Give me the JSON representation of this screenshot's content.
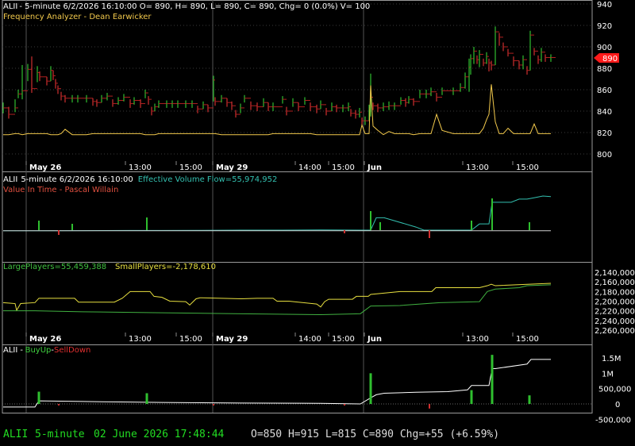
{
  "colors": {
    "background": "#000000",
    "panel_border": "#9a9a9a",
    "grid": "#3a3a3a",
    "up": "#2fbf2f",
    "down": "#d03030",
    "osc": "#f2c94c",
    "teal": "#33c0b0",
    "line_white": "#ffffff",
    "yellow": "#e8e040",
    "green_line": "#40b040",
    "status_green": "#22dd22",
    "status_white": "#dddddd",
    "price_tag": "#ff1a1a"
  },
  "panels": {
    "price": {
      "title_symbol": "ALII",
      "title_rest": "- 5-minute 6/2/2026 16:10:00 O= 890, H= 890, L= 890, C= 890, Chg= 0 (0.0%) V= 100",
      "subtitle": "Frequency Analyzer - Dean Earwicker",
      "last_price_tag": "890",
      "y_ticks": [
        "940",
        "920",
        "900",
        "880",
        "860",
        "840",
        "820",
        "800"
      ]
    },
    "volume": {
      "title_symbol": "ALII",
      "title_rest": "5-minute 6/2/2026 16:10:00",
      "evf_label": "Effective Volume Flow=55,974,952",
      "vit_label": "Value In Time - Pascal Willain"
    },
    "players": {
      "large_label": "LargePlayers=55,459,388",
      "small_label": "SmallPlayers=-2,178,610",
      "y_ticks": [
        "2,140,000",
        "2,160,000",
        "2,180,000",
        "2,200,000",
        "2,220,000",
        "2,240,000",
        "2,260,000"
      ]
    },
    "buyup": {
      "title_symbol": "ALII",
      "dash": "-",
      "buy_label": "BuyUp",
      "sep": "-",
      "sell_label": "SellDown",
      "y_ticks": [
        "1.5M",
        "1M",
        "500,000",
        "0",
        "-500,000"
      ]
    }
  },
  "x_labels": {
    "top": [
      "May 26",
      "13:00",
      "15:00",
      "May 29",
      "14:00",
      "15:00",
      "Jun",
      "13:00",
      "15:00"
    ],
    "middle": [
      "May 26",
      "13:00",
      "15:00",
      "May 29",
      "14:00",
      "15:00",
      "Jun",
      "13:00",
      "15:00"
    ]
  },
  "status_bar": {
    "symbol": "ALII",
    "interval": "5-minute",
    "datetime": "02 June 2026 17:48:44",
    "ohlc": "O=850  H=915  L=815  C=890  Chg=+55 (+6.59%)"
  },
  "chart_data": [
    {
      "type": "line",
      "panel": "price",
      "series": [
        {
          "x": [
            0,
            7,
            15,
            19,
            24,
            31,
            36,
            43,
            46,
            55,
            60,
            63,
            66,
            69,
            73,
            78,
            87,
            94,
            105,
            113,
            118,
            124,
            131,
            138,
            145,
            152,
            160,
            165,
            173,
            179,
            183,
            187,
            191,
            196,
            206,
            213,
            220,
            230,
            238,
            245,
            252,
            258,
            265,
            267,
            275,
            282,
            288,
            293,
            299,
            304,
            312,
            320,
            328,
            334,
            340,
            352,
            357,
            365,
            372,
            380,
            387,
            395,
            400,
            407,
            414,
            420,
            428,
            435,
            438,
            444,
            449,
            452,
            456,
            461,
            463,
            466,
            472,
            479,
            486,
            493,
            501,
            507,
            511,
            517,
            525,
            533,
            539,
            546,
            553,
            567,
            576,
            582,
            587,
            589,
            593,
            597,
            600,
            605,
            609,
            612,
            615,
            620,
            625,
            630,
            636,
            643,
            650,
            655,
            660,
            664,
            669,
            674,
            678,
            683,
            690
          ],
          "close": [
            843,
            837,
            843,
            856,
            859,
            879,
            861,
            876,
            872,
            868,
            878,
            873,
            866,
            861,
            854,
            852,
            852,
            852,
            852,
            849,
            848,
            852,
            854,
            847,
            850,
            853,
            847,
            850,
            847,
            857,
            851,
            840,
            844,
            847,
            847,
            847,
            847,
            847,
            847,
            842,
            846,
            843,
            869,
            849,
            852,
            848,
            845,
            837,
            843,
            852,
            845,
            844,
            848,
            844,
            844,
            851,
            840,
            848,
            844,
            850,
            844,
            842,
            846,
            840,
            844,
            843,
            843,
            844,
            838,
            837,
            839,
            831,
            831,
            842,
            853,
            845,
            843,
            844,
            845,
            845,
            850,
            848,
            851,
            849,
            856,
            856,
            858,
            853,
            859,
            859,
            862,
            872,
            881,
            889,
            896,
            888,
            893,
            885,
            891,
            885,
            883,
            914,
            909,
            900,
            894,
            887,
            883,
            888,
            878,
            911,
            896,
            888,
            895,
            890,
            890
          ],
          "high": [
            848,
            844,
            851,
            860,
            883,
            884,
            891,
            882,
            877,
            872,
            882,
            878,
            870,
            864,
            858,
            855,
            855,
            855,
            855,
            852,
            851,
            855,
            857,
            851,
            853,
            856,
            851,
            853,
            851,
            860,
            854,
            844,
            847,
            850,
            850,
            850,
            850,
            850,
            850,
            845,
            849,
            846,
            873,
            853,
            855,
            852,
            849,
            841,
            847,
            855,
            849,
            848,
            852,
            848,
            848,
            854,
            844,
            852,
            848,
            853,
            848,
            846,
            850,
            843,
            848,
            846,
            846,
            848,
            842,
            841,
            843,
            834,
            835,
            846,
            875,
            848,
            847,
            848,
            849,
            848,
            853,
            852,
            854,
            852,
            860,
            860,
            862,
            857,
            862,
            862,
            866,
            876,
            889,
            893,
            900,
            892,
            897,
            889,
            895,
            889,
            887,
            919,
            913,
            904,
            898,
            891,
            887,
            892,
            882,
            915,
            899,
            892,
            899,
            893,
            893
          ],
          "low": [
            838,
            833,
            839,
            852,
            851,
            868,
            857,
            867,
            868,
            864,
            868,
            869,
            861,
            856,
            850,
            848,
            848,
            848,
            848,
            845,
            844,
            848,
            850,
            844,
            846,
            849,
            843,
            846,
            843,
            852,
            846,
            836,
            840,
            843,
            843,
            843,
            843,
            843,
            843,
            838,
            842,
            839,
            849,
            845,
            848,
            844,
            841,
            834,
            838,
            848,
            841,
            840,
            844,
            840,
            840,
            847,
            836,
            844,
            840,
            846,
            840,
            838,
            842,
            836,
            840,
            839,
            839,
            840,
            835,
            833,
            834,
            827,
            827,
            831,
            835,
            841,
            839,
            840,
            841,
            841,
            846,
            844,
            847,
            845,
            852,
            852,
            854,
            849,
            855,
            855,
            858,
            861,
            858,
            874,
            884,
            884,
            881,
            882,
            884,
            877,
            878,
            883,
            901,
            896,
            891,
            882,
            879,
            879,
            874,
            878,
            892,
            884,
            886,
            886,
            886
          ],
          "osc": [
            818,
            818,
            819,
            819,
            818,
            819,
            819,
            819,
            819,
            819,
            818,
            818,
            818,
            818,
            819,
            823,
            818,
            818,
            818,
            819,
            819,
            819,
            819,
            819,
            819,
            819,
            819,
            819,
            819,
            818,
            818,
            818,
            818,
            819,
            819,
            819,
            819,
            819,
            819,
            819,
            819,
            819,
            819,
            819,
            818,
            818,
            818,
            818,
            818,
            818,
            818,
            818,
            818,
            818,
            819,
            819,
            819,
            819,
            819,
            819,
            819,
            818,
            818,
            818,
            818,
            818,
            818,
            818,
            818,
            818,
            818,
            827,
            819,
            819,
            864,
            826,
            822,
            818,
            821,
            819,
            819,
            819,
            819,
            818,
            819,
            819,
            819,
            837,
            822,
            819,
            819,
            819,
            819,
            819,
            819,
            819,
            819,
            824,
            832,
            837,
            865,
            830,
            819,
            819,
            824,
            819,
            819,
            819,
            819,
            819,
            828,
            819,
            819,
            819,
            819
          ]
        }
      ]
    },
    {
      "type": "bar",
      "panel": "volume",
      "series": [
        {
          "name": "Effective Volume Flow",
          "x": [
            0,
            45,
            100,
            160,
            200,
            250,
            300,
            350,
            400,
            450,
            457,
            463,
            470,
            480,
            520,
            530,
            580,
            586,
            590,
            600,
            612,
            616,
            620,
            640,
            650,
            660,
            670,
            680,
            690
          ],
          "values": [
            -200,
            -200,
            -150,
            -100,
            -100,
            -50,
            0,
            0,
            50,
            0,
            0,
            0,
            4000,
            4000,
            1000,
            0,
            0,
            0,
            0,
            2000,
            2000,
            9000,
            9000,
            9000,
            10000,
            10000,
            10500,
            11000,
            10800
          ]
        },
        {
          "name": "Value In Time",
          "x": [
            0,
            100,
            200,
            300,
            400,
            450,
            463,
            500,
            600,
            690
          ],
          "values": [
            50,
            50,
            50,
            50,
            50,
            50,
            50,
            50,
            50,
            50
          ]
        }
      ]
    },
    {
      "type": "line",
      "panel": "players",
      "ylim": [
        2140000,
        2260000
      ],
      "series": [
        {
          "name": "LargePlayers",
          "x": [
            0,
            15,
            17,
            22,
            40,
            45,
            90,
            95,
            140,
            150,
            160,
            165,
            185,
            190,
            200,
            210,
            230,
            235,
            243,
            248,
            300,
            320,
            340,
            345,
            360,
            395,
            400,
            405,
            410,
            440,
            445,
            460,
            463,
            500,
            540,
            545,
            580,
            600,
            610,
            615,
            620,
            690
          ],
          "values": [
            2203000,
            2205000,
            2219000,
            2205000,
            2203000,
            2194000,
            2194000,
            2202000,
            2202000,
            2194000,
            2180000,
            2180000,
            2180000,
            2190000,
            2192000,
            2200000,
            2201000,
            2208000,
            2195000,
            2193000,
            2195000,
            2194000,
            2194000,
            2200000,
            2200000,
            2206000,
            2212000,
            2201000,
            2196000,
            2196000,
            2190000,
            2190000,
            2186000,
            2180000,
            2180000,
            2172000,
            2172000,
            2172000,
            2168000,
            2165000,
            2168000,
            2163000
          ]
        },
        {
          "name": "SmallPlayers",
          "x": [
            0,
            40,
            100,
            200,
            300,
            400,
            450,
            463,
            500,
            550,
            600,
            610,
            620,
            650,
            660,
            690
          ],
          "values": [
            2220000,
            2220000,
            2222000,
            2224000,
            2226000,
            2228000,
            2226000,
            2210000,
            2209000,
            2203000,
            2201000,
            2180000,
            2175000,
            2172000,
            2168000,
            2166000
          ]
        }
      ]
    },
    {
      "type": "bar",
      "panel": "buyup",
      "ylim": [
        -500000,
        1750000
      ],
      "series": [
        {
          "name": "BuyUp/SellDown line",
          "x": [
            0,
            40,
            45,
            100,
            160,
            200,
            300,
            400,
            450,
            463,
            470,
            480,
            520,
            560,
            585,
            590,
            612,
            616,
            620,
            660,
            665,
            690
          ],
          "values": [
            -100000,
            -100000,
            100000,
            80000,
            60000,
            50000,
            30000,
            20000,
            0,
            200000,
            300000,
            350000,
            380000,
            400000,
            460000,
            600000,
            600000,
            1150000,
            1150000,
            1300000,
            1450000,
            1450000
          ]
        },
        {
          "name": "BuyUp",
          "x": [
            45,
            181,
            463,
            590,
            616,
            663
          ],
          "values": [
            400000,
            350000,
            1000000,
            450000,
            1600000,
            280000
          ]
        },
        {
          "name": "SellDown",
          "x": [
            70,
            265,
            430,
            537
          ],
          "values": [
            -50000,
            -50000,
            -50000,
            -150000
          ]
        }
      ]
    }
  ]
}
